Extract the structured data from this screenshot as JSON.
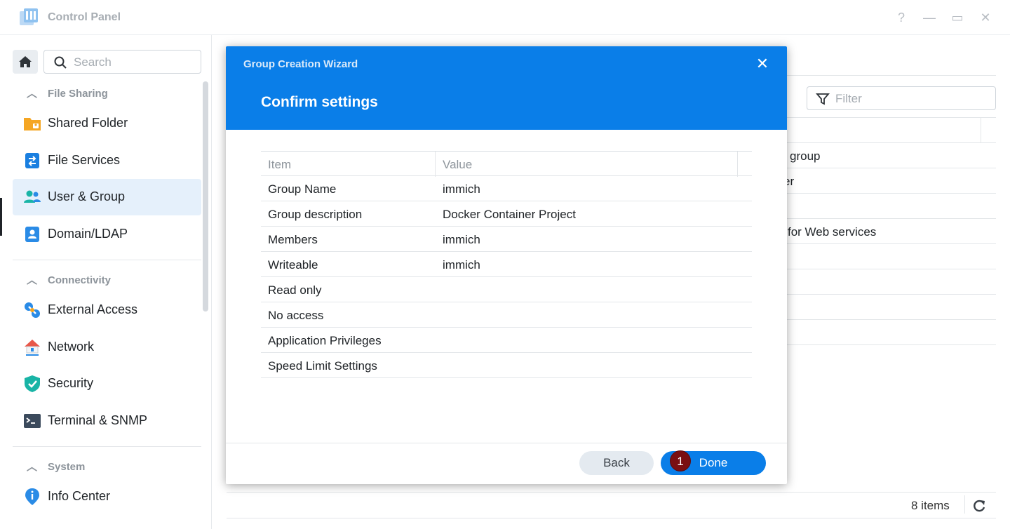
{
  "window": {
    "title": "Control Panel",
    "help_glyph": "?",
    "minimize_glyph": "—",
    "maximize_glyph": "▭",
    "close_glyph": "✕"
  },
  "sidebar": {
    "search_placeholder": "Search",
    "sections": [
      {
        "title": "File Sharing",
        "items": [
          {
            "label": "Shared Folder",
            "icon": "shared-folder-icon"
          },
          {
            "label": "File Services",
            "icon": "file-services-icon"
          },
          {
            "label": "User & Group",
            "icon": "user-group-icon",
            "active": true
          },
          {
            "label": "Domain/LDAP",
            "icon": "domain-ldap-icon"
          }
        ]
      },
      {
        "title": "Connectivity",
        "items": [
          {
            "label": "External Access",
            "icon": "external-access-icon"
          },
          {
            "label": "Network",
            "icon": "network-icon"
          },
          {
            "label": "Security",
            "icon": "security-shield-icon"
          },
          {
            "label": "Terminal & SNMP",
            "icon": "terminal-icon"
          }
        ]
      },
      {
        "title": "System",
        "items": [
          {
            "label": "Info Center",
            "icon": "info-center-icon"
          }
        ]
      }
    ]
  },
  "main": {
    "filter_placeholder": "Filter",
    "visible_fragments": [
      "group",
      "er",
      "for Web services"
    ],
    "items_count": "8 items"
  },
  "wizard": {
    "title": "Group Creation Wizard",
    "close_glyph": "✕",
    "step_title": "Confirm settings",
    "columns": {
      "item": "Item",
      "value": "Value"
    },
    "rows": [
      {
        "item": "Group Name",
        "value": "immich"
      },
      {
        "item": "Group description",
        "value": "Docker Container Project"
      },
      {
        "item": "Members",
        "value": "immich"
      },
      {
        "item": "Writeable",
        "value": "immich"
      },
      {
        "item": "Read only",
        "value": ""
      },
      {
        "item": "No access",
        "value": ""
      },
      {
        "item": "Application Privileges",
        "value": ""
      },
      {
        "item": "Speed Limit Settings",
        "value": ""
      }
    ],
    "back_label": "Back",
    "done_label": "Done",
    "step_badge": "1"
  },
  "colors": {
    "accent": "#0a7ee8",
    "active_nav_bg": "#e5f0fb",
    "badge": "#7a0f12"
  }
}
